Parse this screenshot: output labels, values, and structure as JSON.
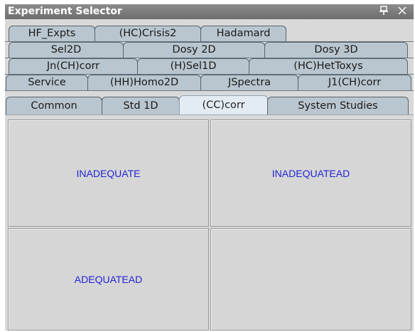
{
  "window": {
    "title": "Experiment Selector",
    "pin_glyph": "■",
    "close_glyph": "×",
    "icons": [
      "pin-icon",
      "close-icon"
    ]
  },
  "tab_rows": [
    [
      "HF_Expts",
      "(HC)Crisis2",
      "Hadamard"
    ],
    [
      "Sel2D",
      "Dosy 2D",
      "Dosy 3D"
    ],
    [
      "Jn(CH)corr",
      "(H)Sel1D",
      "(HC)HetToxys"
    ],
    [
      "Service",
      "(HH)Homo2D",
      "JSpectra",
      "J1(CH)corr"
    ],
    [
      "Common",
      "Std 1D",
      "(CC)corr",
      "System Studies"
    ]
  ],
  "selected_tab": "(CC)corr",
  "experiments": [
    "INADEQUATE",
    "INADEQUATEAD",
    "ADEQUATEAD",
    ""
  ],
  "colors": {
    "tab": "#b9c6cf",
    "tab_selected": "#e4ecf3",
    "link_text": "#2323d6",
    "titlebar": "#7a7a7a"
  }
}
